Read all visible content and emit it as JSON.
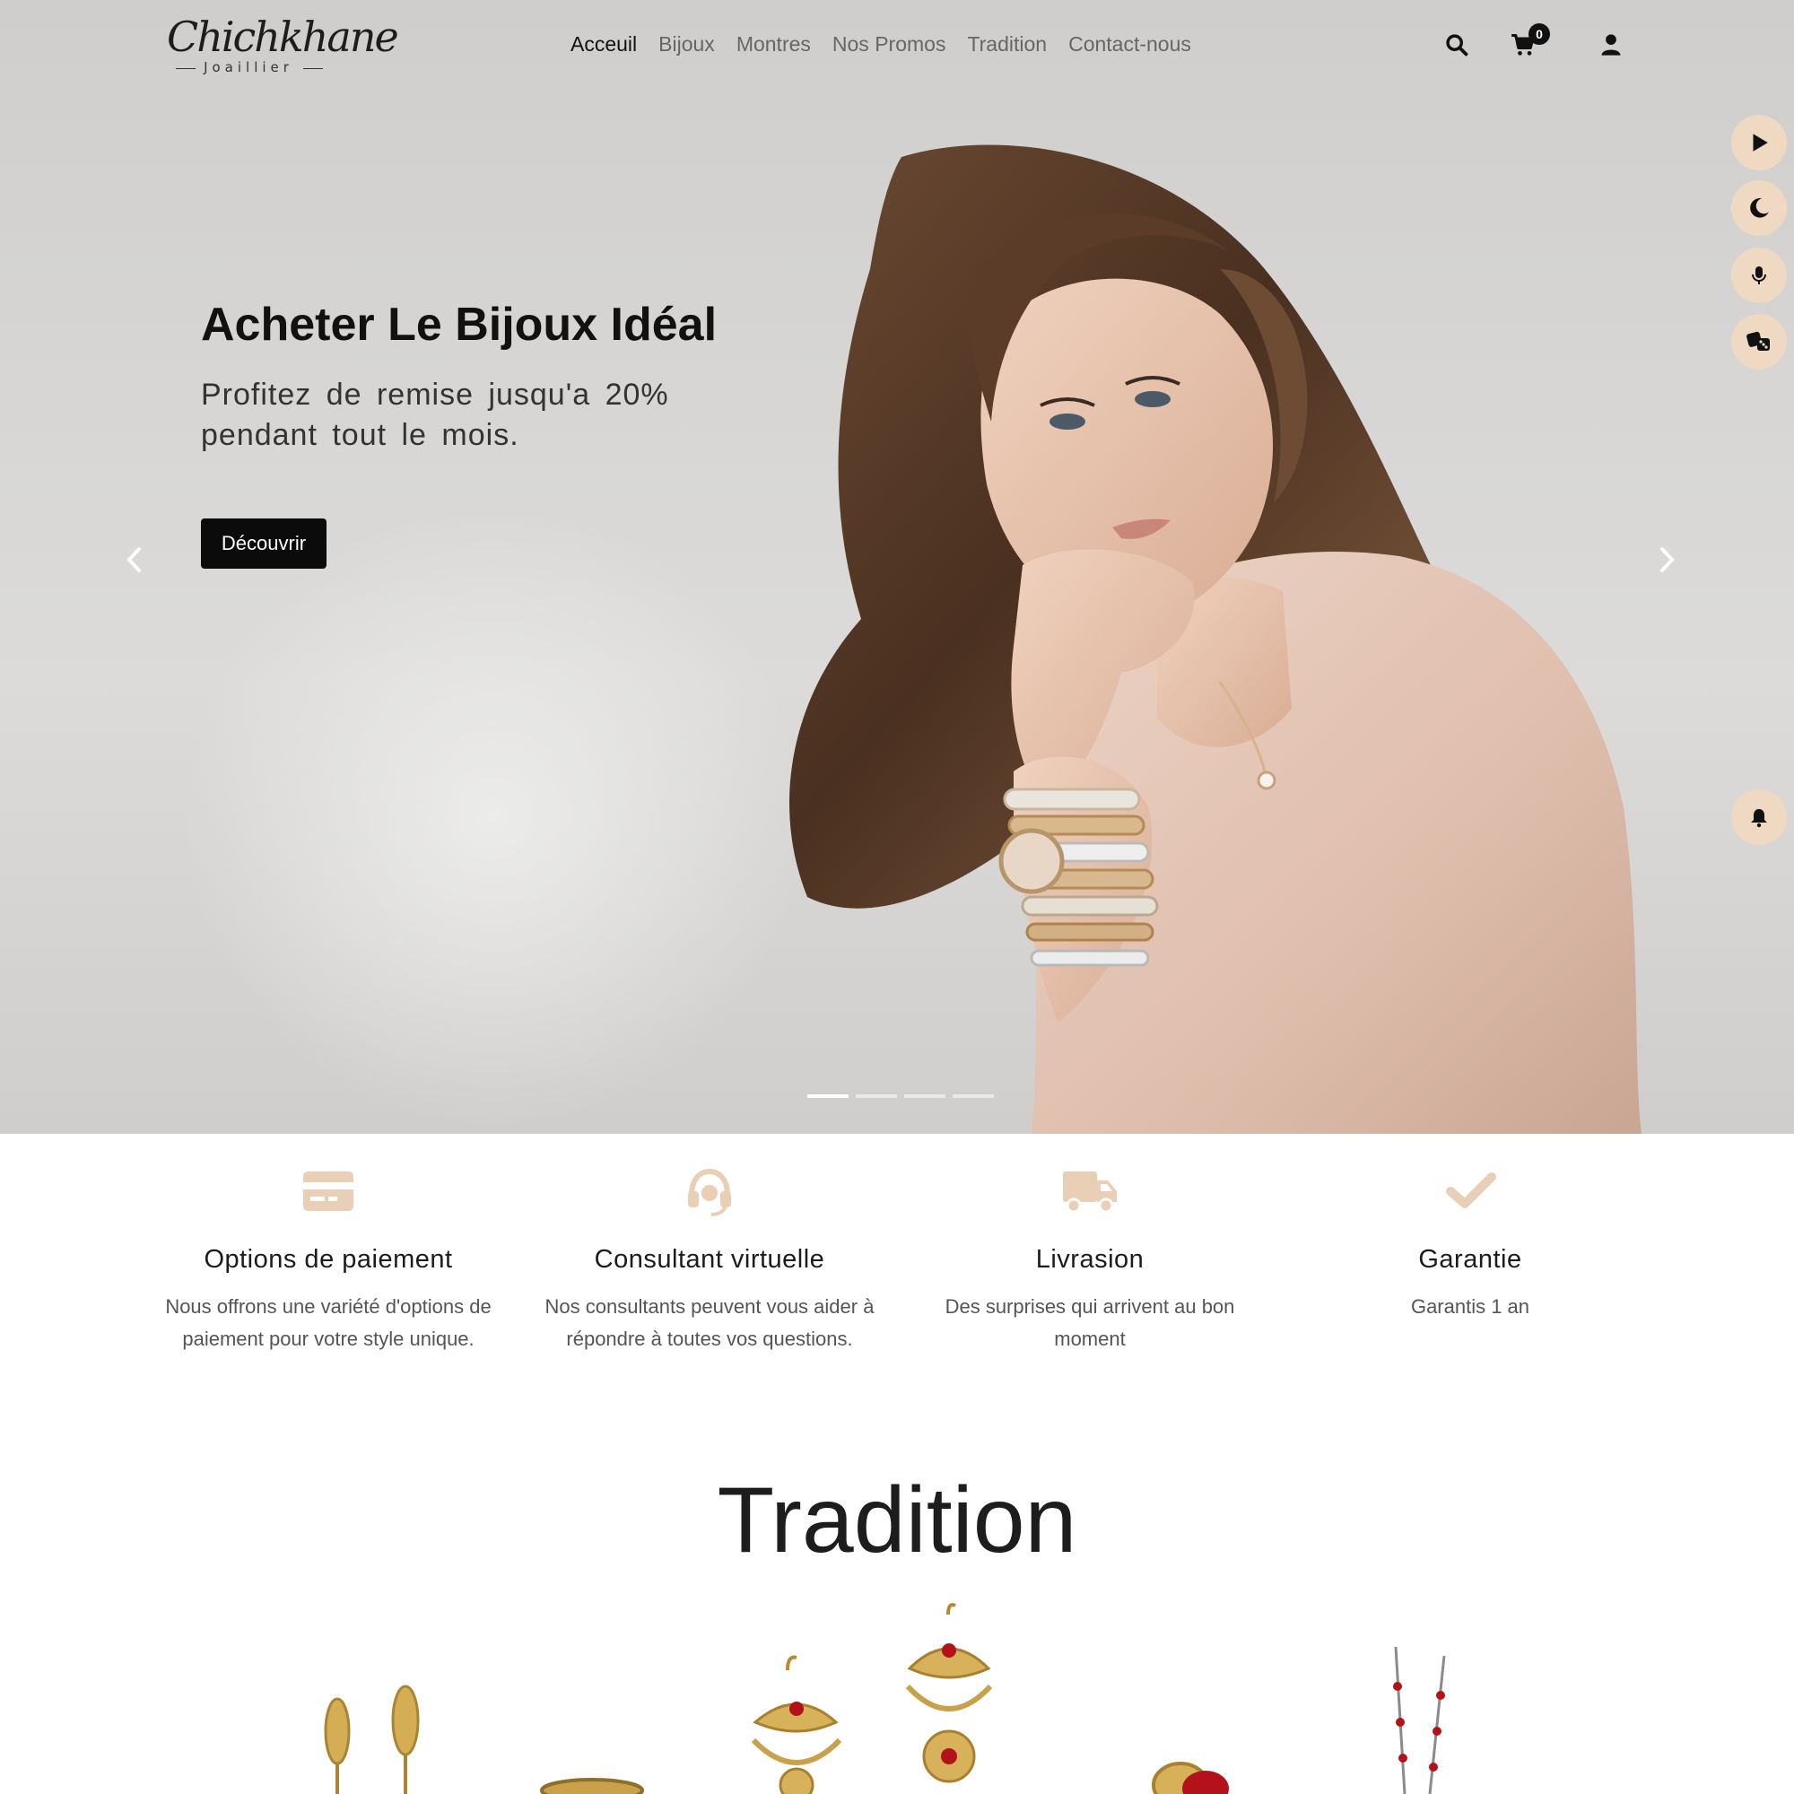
{
  "brand": {
    "logo_script": "Chichkhane",
    "logo_sub": "Joaillier"
  },
  "nav": {
    "items": [
      "Acceuil",
      "Bijoux",
      "Montres",
      "Nos Promos",
      "Tradition",
      "Contact-nous"
    ],
    "active": "Acceuil"
  },
  "header_icons": [
    "search-icon",
    "cart-icon",
    "user-icon"
  ],
  "cart": {
    "count": "0"
  },
  "hero": {
    "title": "Acheter Le Bijoux Idéal",
    "subtitle": "Profitez de remise jusqu'a 20% pendant tout le mois.",
    "cta": "Découvrir",
    "slides_total": 4,
    "active_slide": 1
  },
  "side_buttons": [
    "play-icon",
    "moon-icon",
    "microphone-icon",
    "dice-icon",
    "bell-icon"
  ],
  "features": [
    {
      "icon": "credit-card-icon",
      "title": "Options de paiement",
      "text": "Nous offrons une variété d'options de paiement pour votre style unique."
    },
    {
      "icon": "headset-icon",
      "title": "Consultant virtuelle",
      "text": "Nos consultants peuvent vous aider à répondre à toutes vos questions."
    },
    {
      "icon": "truck-icon",
      "title": "Livrasion",
      "text": "Des surprises qui arrivent au bon moment"
    },
    {
      "icon": "check-icon",
      "title": "Garantie",
      "text": "Garantis 1 an"
    }
  ],
  "tradition": {
    "title": "Tradition"
  },
  "colors": {
    "accent": "#e8cfb6",
    "side_button_bg": "#efd9c2",
    "cta_bg": "#0b0b0b",
    "text_dark": "#111111",
    "nav_muted": "#666666",
    "gold": "#c9a14a",
    "ruby": "#b3121a"
  }
}
